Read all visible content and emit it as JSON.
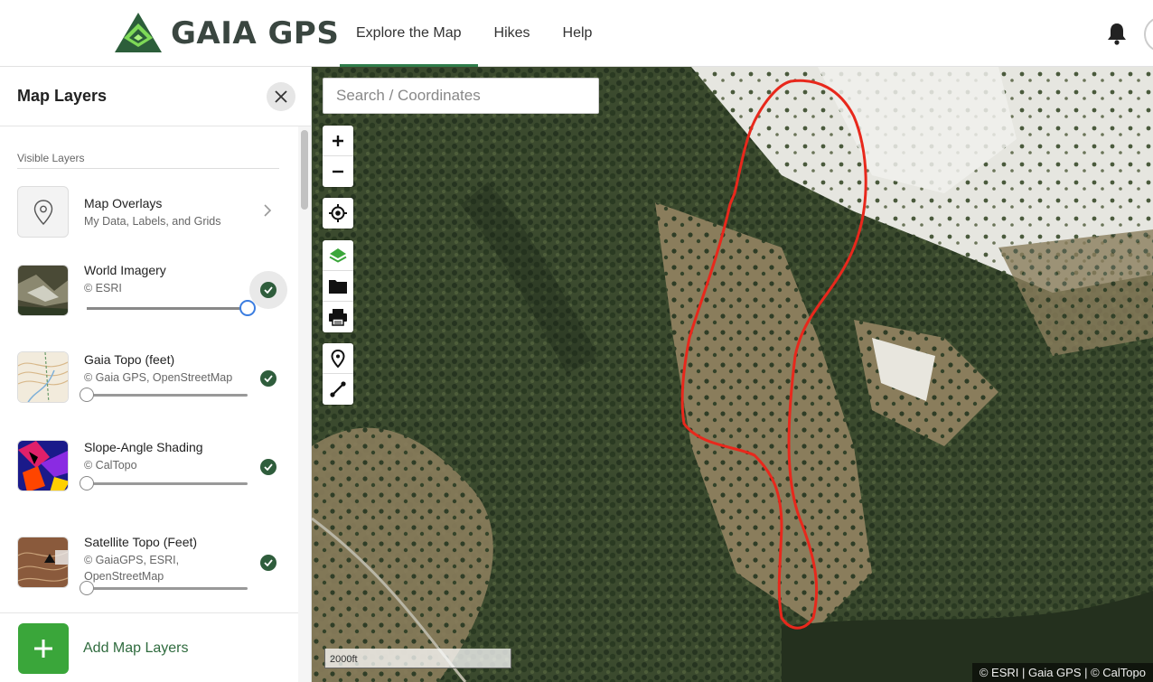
{
  "header": {
    "logo_text": "GAIA GPS",
    "nav": [
      {
        "label": "Explore the Map",
        "active": true
      },
      {
        "label": "Hikes",
        "active": false
      },
      {
        "label": "Help",
        "active": false
      }
    ],
    "icons": [
      "bell-icon"
    ]
  },
  "sidebar": {
    "title": "Map Layers",
    "section_label": "Visible Layers",
    "overlays": {
      "name": "Map Overlays",
      "sub": "My Data, Labels, and Grids",
      "icon": "map-pin-icon"
    },
    "layers": [
      {
        "name": "World Imagery",
        "sub": "© ESRI",
        "opacity_percent": 100,
        "visible": true
      },
      {
        "name": "Gaia Topo (feet)",
        "sub": "© Gaia GPS, OpenStreetMap",
        "opacity_percent": 0,
        "visible": true
      },
      {
        "name": "Slope-Angle Shading",
        "sub": "© CalTopo",
        "opacity_percent": 0,
        "visible": true
      },
      {
        "name": "Satellite Topo (Feet)",
        "sub": "© GaiaGPS, ESRI, OpenStreetMap",
        "opacity_percent": 0,
        "visible": true
      }
    ],
    "add_label": "Add Map Layers"
  },
  "map": {
    "search_placeholder": "Search / Coordinates",
    "controls": [
      "zoom-in-icon",
      "zoom-out-icon",
      "locate-icon",
      "layers-icon",
      "folder-icon",
      "print-icon",
      "marker-icon",
      "route-icon"
    ],
    "scale_label": "2000ft",
    "attribution": "© ESRI | Gaia GPS | © CalTopo",
    "track_color": "#e8281c",
    "accent_green": "#2f7d4b"
  }
}
